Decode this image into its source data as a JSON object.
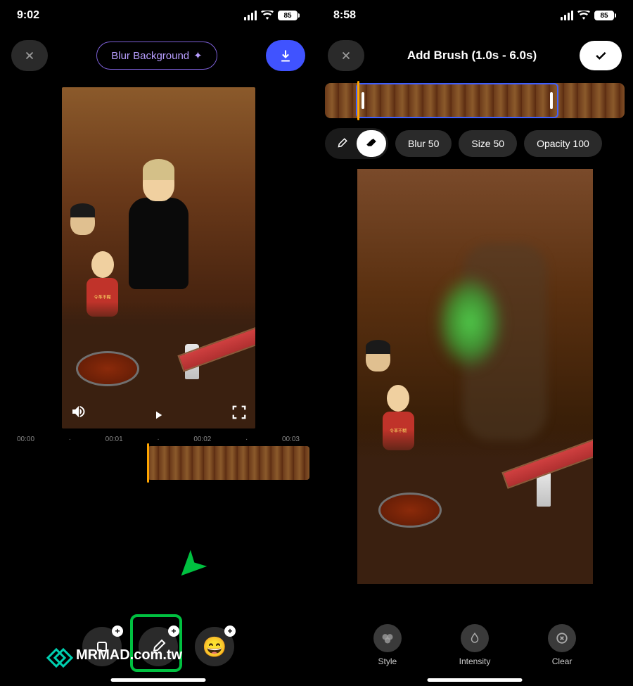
{
  "left": {
    "status": {
      "time": "9:02",
      "battery": "85"
    },
    "header": {
      "blur_bg_label": "Blur Background"
    },
    "timeline": {
      "t0": "00:00",
      "t1": "00:01",
      "t2": "00:02",
      "t3": "00:03"
    },
    "child_apron": "令革不糊"
  },
  "right": {
    "status": {
      "time": "8:58",
      "battery": "85"
    },
    "header": {
      "title": "Add Brush (1.0s - 6.0s)"
    },
    "controls": {
      "blur": "Blur 50",
      "size": "Size 50",
      "opacity": "Opacity 100"
    },
    "tabs": {
      "style": "Style",
      "intensity": "Intensity",
      "clear": "Clear"
    },
    "child_apron": "令革不糊"
  },
  "watermark": "MRMAD.com.tw"
}
